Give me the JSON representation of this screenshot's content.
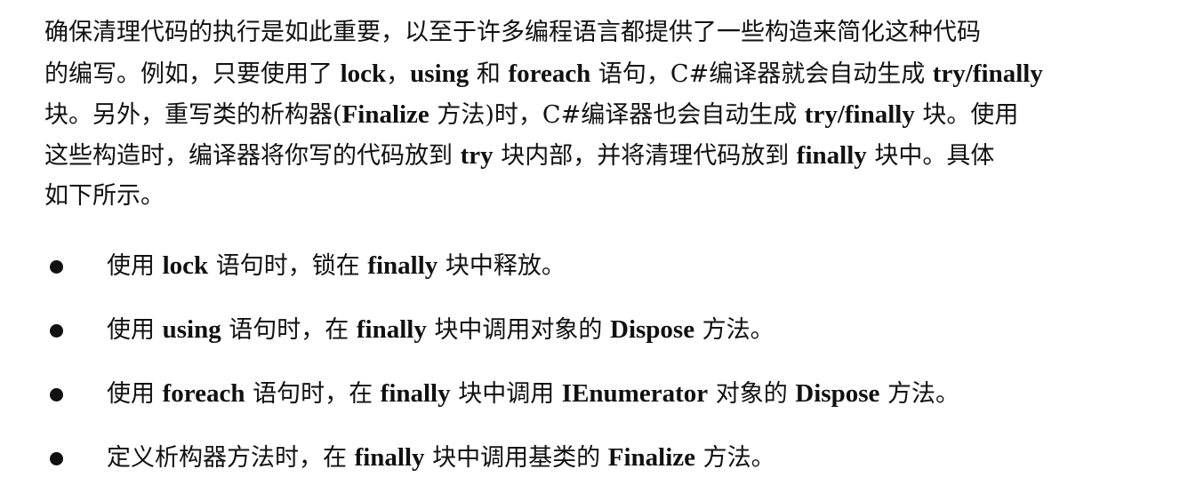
{
  "paragraph": {
    "l1": "确保清理代码的执行是如此重要，以至于许多编程语言都提供了一些构造来简化这种代码",
    "l2_a": "的编写。例如，只要使用了 ",
    "l2_b": "lock",
    "l2_c": "，",
    "l2_d": "using",
    "l2_e": " 和 ",
    "l2_f": "foreach",
    "l2_g": " 语句，C#编译器就会自动生成 ",
    "l2_h": "try/finally",
    "l3_a": "块。另外，重写类的析构器(",
    "l3_b": "Finalize",
    "l3_c": " 方法)时，C#编译器也会自动生成 ",
    "l3_d": "try/finally",
    "l3_e": " 块。使用",
    "l4_a": "这些构造时，编译器将你写的代码放到 ",
    "l4_b": "try",
    "l4_c": " 块内部，并将清理代码放到 ",
    "l4_d": "finally",
    "l4_e": " 块中。具体",
    "l5": "如下所示。"
  },
  "bullets": [
    {
      "a": "使用 ",
      "b": "lock",
      "c": " 语句时，锁在 ",
      "d": "finally",
      "e": " 块中释放。"
    },
    {
      "a": "使用 ",
      "b": "using",
      "c": " 语句时，在 ",
      "d": "finally",
      "e": " 块中调用对象的 ",
      "f": "Dispose",
      "g": " 方法。"
    },
    {
      "a": "使用 ",
      "b": "foreach",
      "c": " 语句时，在 ",
      "d": "finally",
      "e": " 块中调用 ",
      "f": "IEnumerator",
      "g": " 对象的 ",
      "h": "Dispose",
      "i": " 方法。"
    },
    {
      "a": "定义析构器方法时，在 ",
      "b": "finally",
      "c": " 块中调用基类的 ",
      "d": "Finalize",
      "e": " 方法。"
    }
  ]
}
